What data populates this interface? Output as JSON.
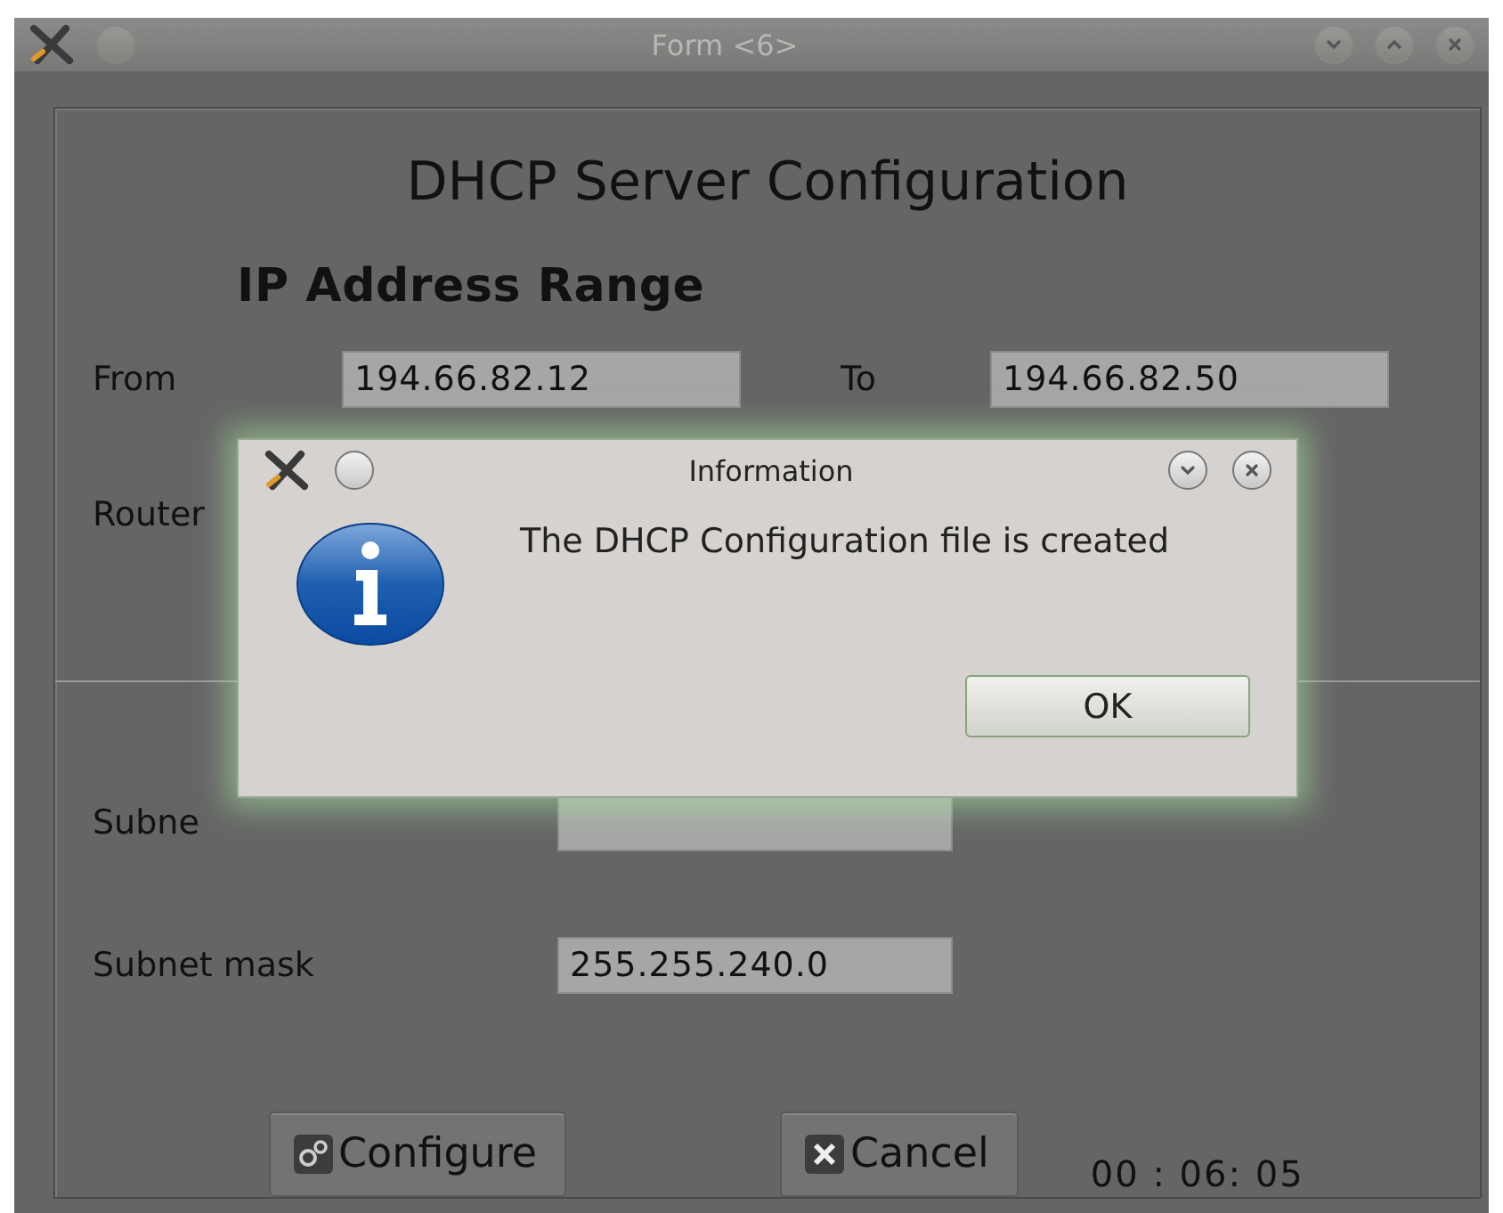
{
  "window": {
    "title": "Form <6>"
  },
  "heading": "DHCP Server Configuration",
  "section": "IP Address Range",
  "range": {
    "from_label": "From",
    "from_value": "194.66.82.12",
    "to_label": "To",
    "to_value": "194.66.82.50"
  },
  "router": {
    "label": "Router"
  },
  "subnet": {
    "label": "Subne"
  },
  "subnet_mask": {
    "label": "Subnet mask",
    "value": "255.255.240.0"
  },
  "buttons": [
    {
      "kind": "configure",
      "label": "Configure"
    },
    {
      "kind": "cancel",
      "label": "Cancel"
    }
  ],
  "timer": "00 : 06: 05",
  "dialog": {
    "title": "Information",
    "message": "The DHCP Configuration file is created",
    "button": "OK"
  }
}
